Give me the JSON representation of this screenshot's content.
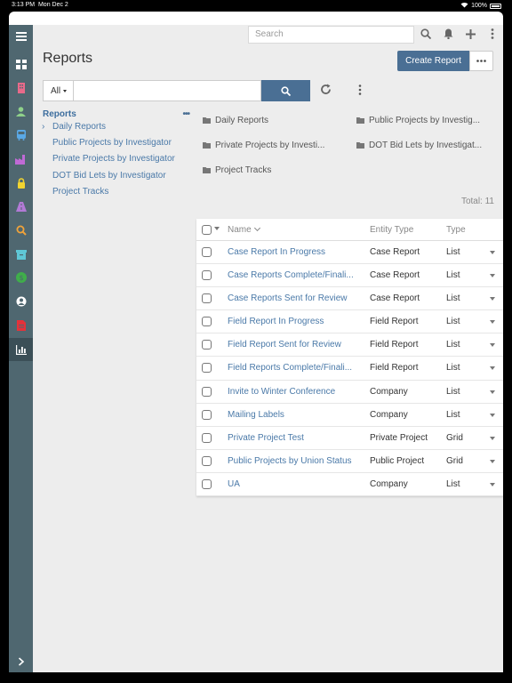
{
  "status": {
    "time": "3:13 PM",
    "date": "Mon Dec 2",
    "battery": "100%"
  },
  "topbar": {
    "search_placeholder": "Search"
  },
  "page": {
    "title": "Reports",
    "create_label": "Create Report"
  },
  "filter": {
    "scope": "All",
    "query": ""
  },
  "tree": {
    "root": "Reports",
    "items": [
      "Daily Reports",
      "Public Projects by Investigator",
      "Private Projects by Investigator",
      "DOT Bid Lets by Investigator",
      "Project Tracks"
    ]
  },
  "folders": [
    "Daily Reports",
    "Public Projects by Investig...",
    "Private Projects by Investi...",
    "DOT Bid Lets by Investigat...",
    "Project Tracks"
  ],
  "total": "Total: 11",
  "table": {
    "headers": {
      "name": "Name",
      "entity": "Entity Type",
      "type": "Type"
    },
    "rows": [
      {
        "name": "Case Report In Progress",
        "entity": "Case Report",
        "type": "List"
      },
      {
        "name": "Case Reports Complete/Finali...",
        "entity": "Case Report",
        "type": "List"
      },
      {
        "name": "Case Reports Sent for Review",
        "entity": "Case Report",
        "type": "List"
      },
      {
        "name": "Field Report In Progress",
        "entity": "Field Report",
        "type": "List"
      },
      {
        "name": "Field Report Sent for Review",
        "entity": "Field Report",
        "type": "List"
      },
      {
        "name": "Field Reports Complete/Finali...",
        "entity": "Field Report",
        "type": "List"
      },
      {
        "name": "Invite to Winter Conference",
        "entity": "Company",
        "type": "List"
      },
      {
        "name": "Mailing Labels",
        "entity": "Company",
        "type": "List"
      },
      {
        "name": "Private Project Test",
        "entity": "Private Project",
        "type": "Grid"
      },
      {
        "name": "Public Projects by Union Status",
        "entity": "Public Project",
        "type": "Grid"
      },
      {
        "name": "UA",
        "entity": "Company",
        "type": "List"
      }
    ]
  },
  "colors": {
    "rail": "#4f6770",
    "accent": "#4a6f94",
    "link": "#4a79a8"
  }
}
